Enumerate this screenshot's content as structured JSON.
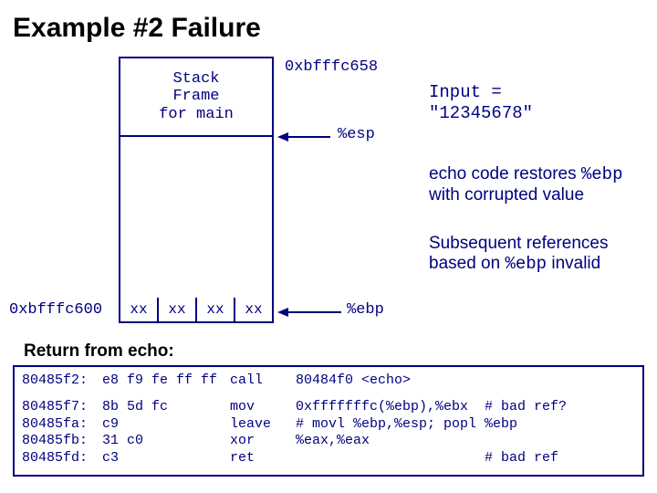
{
  "title": "Example #2 Failure",
  "stack": {
    "main_label": "Stack\nFrame\nfor main",
    "addr_top": "0xbfffc658",
    "esp": "%esp",
    "ebp": "%ebp",
    "addr_ebp": "0xbfffc600",
    "cells": [
      "xx",
      "xx",
      "xx",
      "xx"
    ]
  },
  "input": {
    "label": "Input =",
    "value": "\"12345678\""
  },
  "notes": {
    "n1_a": "echo code restores ",
    "n1_b": "%ebp",
    "n1_c": "with corrupted value",
    "n2_a": "Subsequent references",
    "n2_b": "based on ",
    "n2_c": "%ebp",
    "n2_d": " invalid"
  },
  "return_label": "Return from echo:",
  "asm": {
    "r0": {
      "addr": "80485f2:",
      "bytes": "e8 f9 fe ff ff",
      "mnem": "call",
      "args": "80484f0 <echo>"
    },
    "r1": {
      "addr": "80485f7:",
      "bytes": "8b 5d fc",
      "mnem": "mov",
      "args": "0xfffffffc(%ebp),%ebx  # bad ref?"
    },
    "r2": {
      "addr": "80485fa:",
      "bytes": "c9",
      "mnem": "leave",
      "args": "# movl %ebp,%esp; popl %ebp"
    },
    "r3": {
      "addr": "80485fb:",
      "bytes": "31 c0",
      "mnem": "xor",
      "args": "%eax,%eax"
    },
    "r4": {
      "addr": "80485fd:",
      "bytes": "c3",
      "mnem": "ret",
      "args": "                       # bad ref"
    }
  }
}
